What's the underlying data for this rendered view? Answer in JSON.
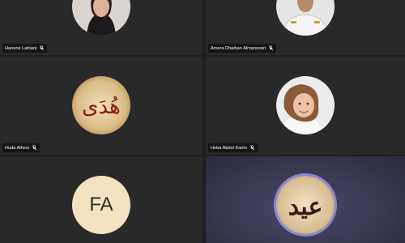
{
  "participants": [
    {
      "name": "Hanene Lahiani"
    },
    {
      "name": "Amera Dhaiban Almansoori"
    },
    {
      "name": "Huda Alherz"
    },
    {
      "name": "Heba Abdul Karim"
    },
    {
      "initials": "FA"
    },
    {}
  ],
  "avatar_calligraphy": {
    "huda": "هُدَى",
    "active": "عيد"
  },
  "colors": {
    "background": "#1f1f1f",
    "tile": "#292929",
    "active_ring": "#8b86d8",
    "initials_bg": "#f3e2bf",
    "calligraphy_red": "#8a1a14"
  },
  "icons": [
    "mic-muted-icon"
  ]
}
